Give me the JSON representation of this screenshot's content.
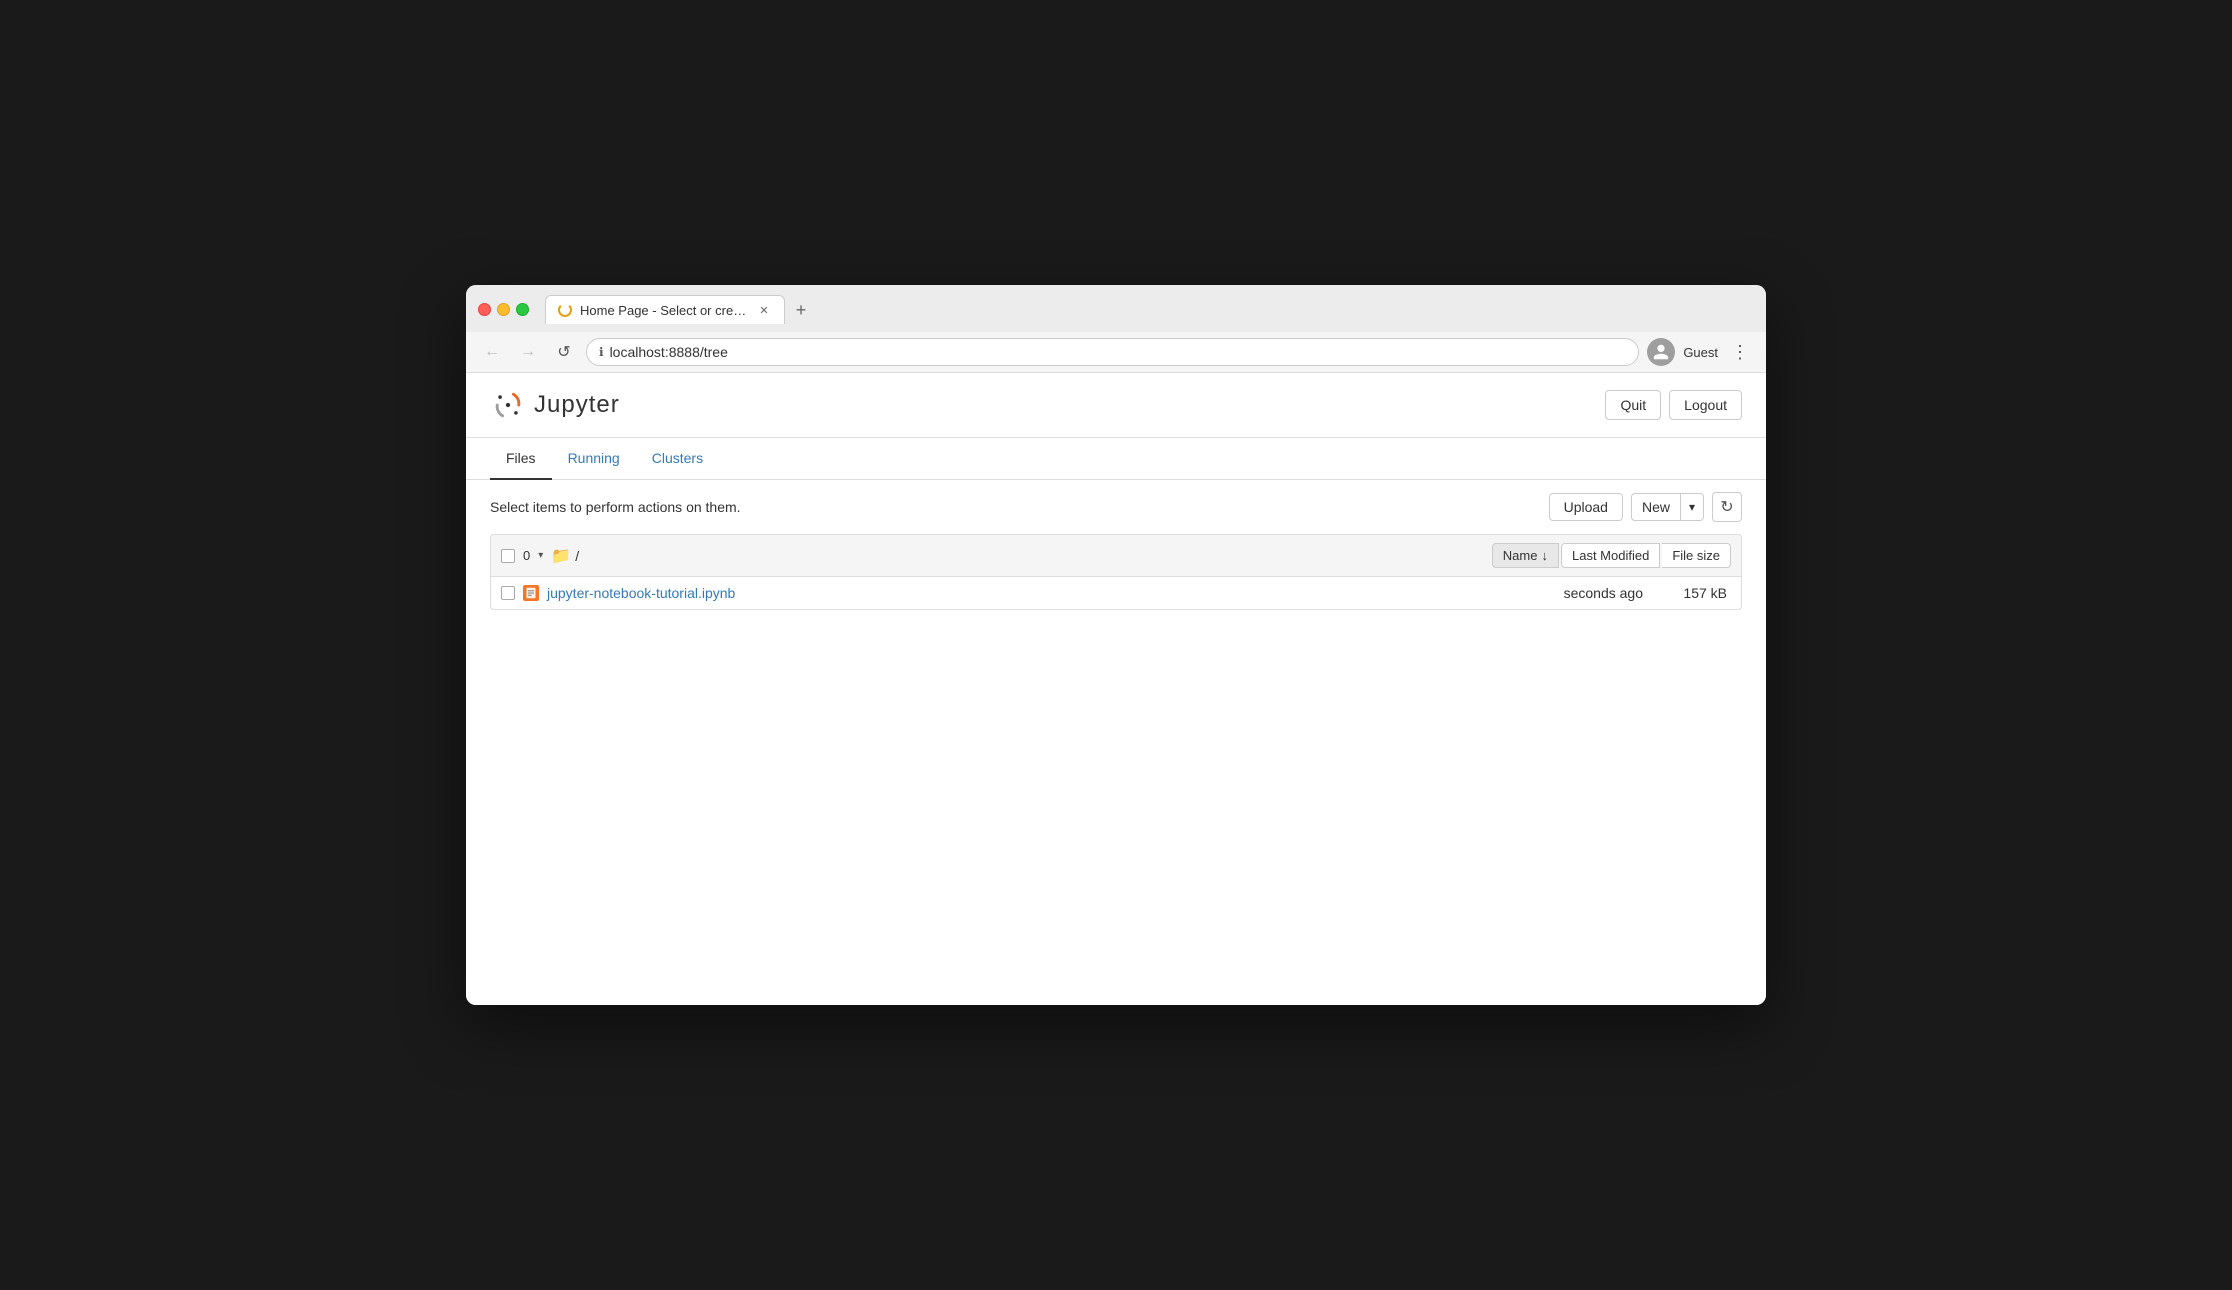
{
  "browser": {
    "tab_title": "Home Page - Select or create a",
    "tab_new_label": "+",
    "url": "localhost:8888/tree",
    "back_btn": "←",
    "forward_btn": "→",
    "reload_btn": "↺",
    "guest_label": "Guest",
    "menu_dots": "⋮"
  },
  "jupyter": {
    "logo_text": "Jupyter",
    "quit_label": "Quit",
    "logout_label": "Logout"
  },
  "tabs": [
    {
      "label": "Files",
      "active": true
    },
    {
      "label": "Running",
      "active": false
    },
    {
      "label": "Clusters",
      "active": false
    }
  ],
  "file_browser": {
    "toolbar_text": "Select items to perform actions on them.",
    "upload_label": "Upload",
    "new_label": "New",
    "new_caret": "▾",
    "refresh_icon": "↻",
    "count": "0",
    "path": "/",
    "sort_name_label": "Name",
    "sort_name_arrow": "↓",
    "sort_modified_label": "Last Modified",
    "sort_size_label": "File size"
  },
  "files": [
    {
      "name": "jupyter-notebook-tutorial.ipynb",
      "modified": "seconds ago",
      "size": "157 kB"
    }
  ]
}
